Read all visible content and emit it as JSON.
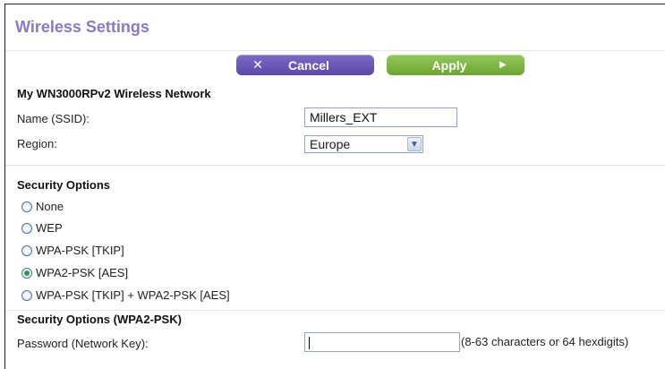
{
  "page": {
    "title": "Wireless Settings"
  },
  "toolbar": {
    "cancel_label": "Cancel",
    "cancel_icon": "close-icon",
    "apply_label": "Apply",
    "apply_icon": "play-arrow-icon",
    "cancel_color": "#6a57b8",
    "apply_color": "#7db742"
  },
  "network": {
    "heading": "My WN3000RPv2 Wireless Network",
    "ssid_label": "Name (SSID):",
    "ssid_value": "Millers_EXT",
    "region_label": "Region:",
    "region_value": "Europe"
  },
  "security": {
    "heading": "Security Options",
    "options": [
      {
        "label": "None",
        "checked": false
      },
      {
        "label": "WEP",
        "checked": false
      },
      {
        "label": "WPA-PSK [TKIP]",
        "checked": false
      },
      {
        "label": "WPA2-PSK [AES]",
        "checked": true
      },
      {
        "label": "WPA-PSK [TKIP] + WPA2-PSK [AES]",
        "checked": false
      }
    ]
  },
  "wpa2": {
    "heading": "Security Options (WPA2-PSK)",
    "password_label": "Password (Network Key):",
    "password_value": "",
    "password_hint": "(8-63 characters or 64 hexdigits)"
  }
}
